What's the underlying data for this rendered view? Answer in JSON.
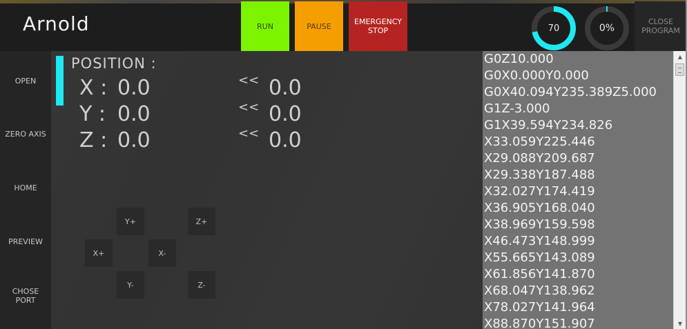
{
  "app": {
    "title": "Arnold"
  },
  "toolbar": {
    "run": "RUN",
    "pause": "PAUSE",
    "emergency_stop": "EMERGENCY STOP",
    "close_program": "CLOSE PROGRAM"
  },
  "gauges": {
    "speed": {
      "label": "70",
      "fraction": 0.72,
      "color": "#1de9f2"
    },
    "progress": {
      "label": "0%",
      "fraction": 0.0,
      "color": "#1de9f2"
    }
  },
  "sidebar": {
    "items": [
      {
        "label": "OPEN"
      },
      {
        "label": "ZERO AXIS"
      },
      {
        "label": "HOME"
      },
      {
        "label": "PREVIEW"
      },
      {
        "label": "CHOSE PORT"
      }
    ]
  },
  "position": {
    "title": "POSITION :",
    "axes": [
      {
        "label": "X :",
        "current": "0.0",
        "arrow": "<<",
        "target": "0.0"
      },
      {
        "label": "Y :",
        "current": "0.0",
        "arrow": "<<",
        "target": "0.0"
      },
      {
        "label": "Z :",
        "current": "0.0",
        "arrow": "<<",
        "target": "0.0"
      }
    ]
  },
  "jog": {
    "y_plus": "Y+",
    "z_plus": "Z+",
    "x_plus": "X+",
    "x_minus": "X-",
    "y_minus": "Y-",
    "z_minus": "Z-"
  },
  "gcode": {
    "lines": [
      "G0Z10.000",
      "G0X0.000Y0.000",
      "G0X40.094Y235.389Z5.000",
      "G1Z-3.000",
      "G1X39.594Y234.826",
      "X33.059Y225.446",
      "X29.088Y209.687",
      "X29.338Y187.488",
      "X32.027Y174.419",
      "X36.905Y168.040",
      "X38.969Y159.598",
      "X46.473Y148.999",
      "X55.665Y143.089",
      "X61.856Y141.870",
      "X68.047Y138.962",
      "X78.027Y141.964",
      "X88.870Y151.907"
    ]
  },
  "colors": {
    "accent": "#1de9f2",
    "run": "#7cf400",
    "pause": "#f59e00",
    "stop": "#b52422"
  }
}
